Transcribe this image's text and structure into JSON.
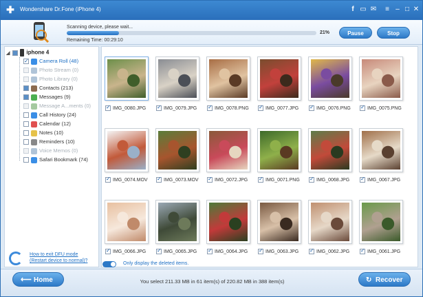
{
  "window": {
    "title": "Wondershare Dr.Fone (iPhone 4)"
  },
  "titlebar_icons": [
    "facebook-icon",
    "chat-icon",
    "feedback-icon",
    "menu-icon",
    "minimize-icon",
    "maximize-icon",
    "close-icon"
  ],
  "scan": {
    "status_text": "Scanning device, please wait...",
    "progress_percent": 21,
    "progress_label": "21%",
    "remaining_time": "Remaining Time: 00:29:10",
    "pause_label": "Pause",
    "stop_label": "Stop"
  },
  "sidebar": {
    "root_label": "iphone 4",
    "items": [
      {
        "label": "Camera Roll (48)",
        "checked": "on",
        "state": "selected",
        "icon_color": "#3a8ee6"
      },
      {
        "label": "Photo Stream (0)",
        "checked": "dis",
        "state": "dim",
        "icon_color": "#b0c4d8"
      },
      {
        "label": "Photo Library (0)",
        "checked": "dis",
        "state": "dim",
        "icon_color": "#b0c4d8"
      },
      {
        "label": "Contacts (213)",
        "checked": "part",
        "state": "normal",
        "icon_color": "#8c6b4f"
      },
      {
        "label": "Messages (9)",
        "checked": "part",
        "state": "normal",
        "icon_color": "#4caf50"
      },
      {
        "label": "Message A...ments (0)",
        "checked": "dis",
        "state": "dim",
        "icon_color": "#a5c9a0"
      },
      {
        "label": "Call History (24)",
        "checked": "off",
        "state": "normal",
        "icon_color": "#3a8ee6"
      },
      {
        "label": "Calendar (12)",
        "checked": "off",
        "state": "normal",
        "icon_color": "#e05050"
      },
      {
        "label": "Notes (10)",
        "checked": "off",
        "state": "normal",
        "icon_color": "#e6c24a"
      },
      {
        "label": "Reminders (10)",
        "checked": "off",
        "state": "normal",
        "icon_color": "#888888"
      },
      {
        "label": "Voice Memos (0)",
        "checked": "dis",
        "state": "dim",
        "icon_color": "#b0c4d8"
      },
      {
        "label": "Safari Bookmark (74)",
        "checked": "off",
        "state": "normal",
        "icon_color": "#3a8ee6"
      }
    ],
    "help_line1": "How to exit DFU mode",
    "help_line2": "(Restart device to normal)?"
  },
  "photos": [
    {
      "name": "IMG_0080.JPG",
      "palette": [
        "#6d8f4a",
        "#c9b48c",
        "#3f5e2a"
      ]
    },
    {
      "name": "IMG_0079.JPG",
      "palette": [
        "#8a8d93",
        "#d9d2c6",
        "#4b4f57"
      ]
    },
    {
      "name": "IMG_0078.PNG",
      "palette": [
        "#a86e45",
        "#e0c3a1",
        "#5a3a25"
      ]
    },
    {
      "name": "IMG_0077.JPG",
      "palette": [
        "#7a4d2e",
        "#c2413c",
        "#3c2a1c"
      ]
    },
    {
      "name": "IMG_0076.PNG",
      "palette": [
        "#e0b84a",
        "#7a4ca0",
        "#4a3a2a"
      ]
    },
    {
      "name": "IMG_0075.PNG",
      "palette": [
        "#c78a7a",
        "#e8d4c0",
        "#8a5a4a"
      ]
    },
    {
      "name": "IMG_0074.MOV",
      "palette": [
        "#f4f4f4",
        "#c25a3a",
        "#9ab0c8"
      ]
    },
    {
      "name": "IMG_0073.MOV",
      "palette": [
        "#5a7d3a",
        "#a7552e",
        "#2f3f20"
      ]
    },
    {
      "name": "IMG_0072.JPG",
      "palette": [
        "#8a5a3a",
        "#c94a5a",
        "#e6d6c0"
      ]
    },
    {
      "name": "IMG_0071.PNG",
      "palette": [
        "#3d6a2a",
        "#8fb04a",
        "#5a3a22"
      ]
    },
    {
      "name": "IMG_0068.JPG",
      "palette": [
        "#5d7d4a",
        "#c24a3a",
        "#2a3a20"
      ]
    },
    {
      "name": "IMG_0067.JPG",
      "palette": [
        "#a0704a",
        "#e6dac8",
        "#5a4030"
      ]
    },
    {
      "name": "IMG_0066.JPG",
      "palette": [
        "#e8c0a0",
        "#f6e8dc",
        "#c08a6a"
      ]
    },
    {
      "name": "IMG_0065.JPG",
      "palette": [
        "#9aa8b4",
        "#3f4a38",
        "#6d7a5a"
      ]
    },
    {
      "name": "IMG_0064.JPG",
      "palette": [
        "#4d7a3a",
        "#c23a3a",
        "#2a4020"
      ]
    },
    {
      "name": "IMG_0063.JPG",
      "palette": [
        "#7a5a42",
        "#d8c0a8",
        "#3a2a20"
      ]
    },
    {
      "name": "IMG_0062.JPG",
      "palette": [
        "#c09070",
        "#e6d8c8",
        "#6a4a3a"
      ]
    },
    {
      "name": "IMG_0061.JPG",
      "palette": [
        "#6a9a4a",
        "#b0a090",
        "#3a5a2a"
      ]
    }
  ],
  "toggle": {
    "label": "Only display the deleted items.",
    "on": true
  },
  "footer": {
    "home_label": "Home",
    "recover_label": "Recover",
    "selection_summary": "You select 211.33 MB in 61 item(s) of 220.82 MB in 388 item(s)"
  }
}
